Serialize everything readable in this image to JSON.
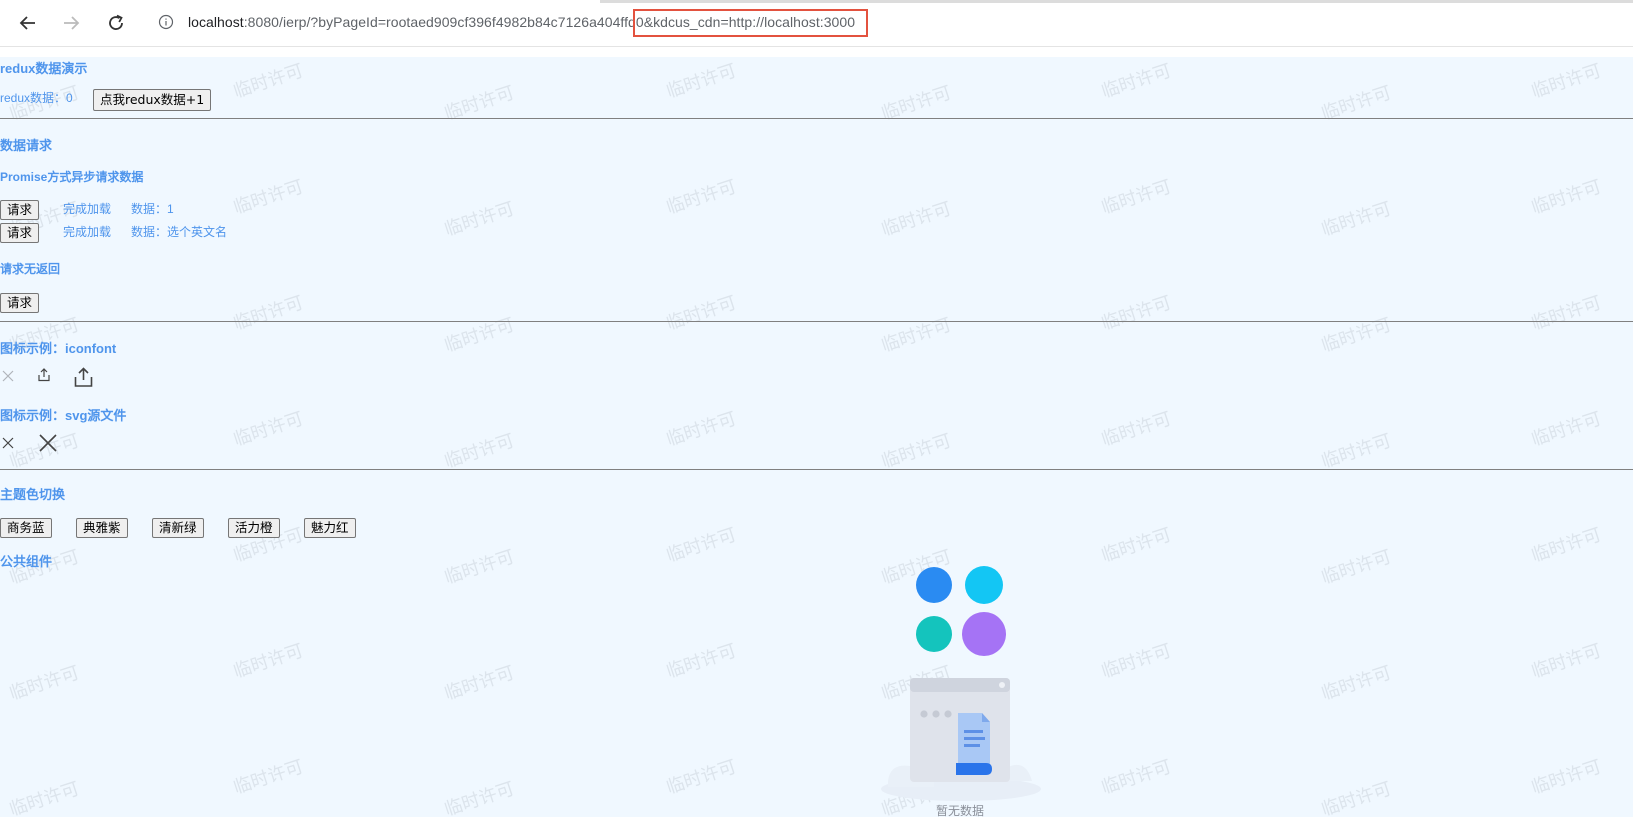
{
  "browser": {
    "url_host": "localhost",
    "url_rest": ":8080/ierp/?byPageId=rootaed909cf396f4982b84c7126a404ffd0&kdcus_cdn=http://localhost:3000",
    "icons": [
      "back-arrow-icon",
      "forward-arrow-icon",
      "reload-icon",
      "info-icon"
    ],
    "highlight_color": "#e3523f"
  },
  "watermark_text": "临时许可",
  "redux": {
    "title": "redux数据演示",
    "data_label": "redux数据：0",
    "increment_button": "点我redux数据+1"
  },
  "request": {
    "title": "数据请求",
    "promise_title": "Promise方式异步请求数据",
    "rows": [
      {
        "button": "请求",
        "status": "完成加载",
        "data": "数据：1"
      },
      {
        "button": "请求",
        "status": "完成加载",
        "data": "数据：选个英文名"
      }
    ],
    "no_return_title": "请求无返回",
    "no_return_button": "请求"
  },
  "icons_demo": {
    "iconfont_title": "图标示例：iconfont",
    "iconfont_icons": [
      "close-icon",
      "share-icon",
      "share-large-icon"
    ],
    "svg_title": "图标示例：svg源文件",
    "svg_icons": [
      "close-icon",
      "close-large-icon"
    ]
  },
  "theme": {
    "title": "主题色切换",
    "buttons": [
      "商务蓝",
      "典雅紫",
      "清新绿",
      "活力橙",
      "魅力红"
    ]
  },
  "common": {
    "title": "公共组件",
    "empty_text": "暂无数据",
    "dot_colors": [
      "#2a8bf2",
      "#13c6f4",
      "#14c4bd",
      "#a573f5"
    ]
  },
  "colors": {
    "accent": "#4f95ec",
    "page_bg": "#f0f8ff"
  }
}
